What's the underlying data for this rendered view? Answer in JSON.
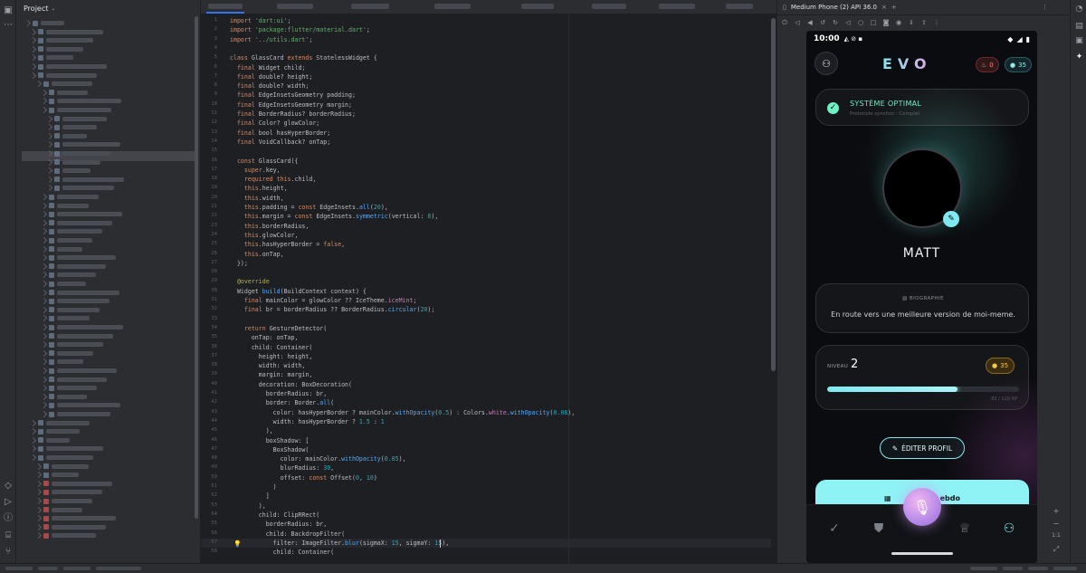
{
  "ide": {
    "project_title": "Project",
    "editor": {
      "lines": [
        {
          "n": "1",
          "html": "<span class='kw'>import</span> <span class='str'>'dart:ui'</span>;"
        },
        {
          "n": "2",
          "html": "<span class='kw'>import</span> <span class='str'>'package:flutter/material.dart'</span>;"
        },
        {
          "n": "3",
          "html": "<span class='kw'>import</span> <span class='str'>'../utils.dart'</span>;"
        },
        {
          "n": "4",
          "html": ""
        },
        {
          "n": "5",
          "html": "<span class='kw'>class</span> GlassCard <span class='kw'>extends</span> StatelessWidget {"
        },
        {
          "n": "6",
          "html": "  <span class='kw'>final</span> Widget child;"
        },
        {
          "n": "7",
          "html": "  <span class='kw'>final</span> double? height;"
        },
        {
          "n": "8",
          "html": "  <span class='kw'>final</span> double? width;"
        },
        {
          "n": "9",
          "html": "  <span class='kw'>final</span> EdgeInsetsGeometry padding;"
        },
        {
          "n": "10",
          "html": "  <span class='kw'>final</span> EdgeInsetsGeometry margin;"
        },
        {
          "n": "11",
          "html": "  <span class='kw'>final</span> BorderRadius? borderRadius;"
        },
        {
          "n": "12",
          "html": "  <span class='kw'>final</span> Color? glowColor;"
        },
        {
          "n": "13",
          "html": "  <span class='kw'>final</span> bool hasHyperBorder;"
        },
        {
          "n": "14",
          "html": "  <span class='kw'>final</span> VoidCallback? onTap;"
        },
        {
          "n": "15",
          "html": ""
        },
        {
          "n": "16",
          "html": "  <span class='kw'>const</span> GlassCard({"
        },
        {
          "n": "17",
          "html": "    <span class='kw'>super</span>.key,"
        },
        {
          "n": "18",
          "html": "    <span class='kw'>required this</span>.child,"
        },
        {
          "n": "19",
          "html": "    <span class='kw'>this</span>.height,"
        },
        {
          "n": "20",
          "html": "    <span class='kw'>this</span>.width,"
        },
        {
          "n": "21",
          "html": "    <span class='kw'>this</span>.padding = <span class='kw'>const</span> EdgeInsets.<span class='fn'>all</span>(<span class='num'>20</span>),"
        },
        {
          "n": "22",
          "html": "    <span class='kw'>this</span>.margin = <span class='kw'>const</span> EdgeInsets.<span class='fn'>symmetric</span>(vertical: <span class='num'>8</span>),"
        },
        {
          "n": "23",
          "html": "    <span class='kw'>this</span>.borderRadius,"
        },
        {
          "n": "24",
          "html": "    <span class='kw'>this</span>.glowColor,"
        },
        {
          "n": "25",
          "html": "    <span class='kw'>this</span>.hasHyperBorder = <span class='kw'>false</span>,"
        },
        {
          "n": "26",
          "html": "    <span class='kw'>this</span>.onTap,"
        },
        {
          "n": "27",
          "html": "  });"
        },
        {
          "n": "28",
          "html": ""
        },
        {
          "n": "29",
          "html": "  <span class='ann'>@override</span>"
        },
        {
          "n": "30",
          "html": "  Widget <span class='fn'>build</span>(BuildContext context) {"
        },
        {
          "n": "31",
          "html": "    <span class='kw'>final</span> mainColor = glowColor ?? IceTheme.<span class='fld'>iceMint</span>;"
        },
        {
          "n": "32",
          "html": "    <span class='kw'>final</span> br = borderRadius ?? BorderRadius.<span class='fn'>circular</span>(<span class='num'>20</span>);"
        },
        {
          "n": "33",
          "html": ""
        },
        {
          "n": "34",
          "html": "    <span class='kw'>return</span> GestureDetector("
        },
        {
          "n": "35",
          "html": "      onTap: onTap,"
        },
        {
          "n": "36",
          "html": "      child: Container("
        },
        {
          "n": "37",
          "html": "        height: height,"
        },
        {
          "n": "38",
          "html": "        width: width,"
        },
        {
          "n": "39",
          "html": "        margin: margin,"
        },
        {
          "n": "40",
          "html": "        decoration: BoxDecoration("
        },
        {
          "n": "41",
          "html": "          borderRadius: br,"
        },
        {
          "n": "42",
          "html": "          border: Border.<span class='fn'>all</span>("
        },
        {
          "n": "43",
          "html": "            color: hasHyperBorder ? mainColor.<span class='fn'>withOpacity</span>(<span class='num'>0.5</span>) : Colors.<span class='fld'>white</span>.<span class='fn'>withOpacity</span>(<span class='num'>0.08</span>),"
        },
        {
          "n": "44",
          "html": "            width: hasHyperBorder ? <span class='num'>1.5</span> : <span class='num'>1</span>"
        },
        {
          "n": "45",
          "html": "          ),"
        },
        {
          "n": "46",
          "html": "          boxShadow: ["
        },
        {
          "n": "47",
          "html": "            BoxShadow("
        },
        {
          "n": "48",
          "html": "              color: mainColor.<span class='fn'>withOpacity</span>(<span class='num'>0.05</span>),"
        },
        {
          "n": "49",
          "html": "              blurRadius: <span class='num'>30</span>,"
        },
        {
          "n": "50",
          "html": "              offset: <span class='kw'>const</span> Offset(<span class='num'>0</span>, <span class='num'>10</span>)"
        },
        {
          "n": "51",
          "html": "            )"
        },
        {
          "n": "52",
          "html": "          ]"
        },
        {
          "n": "53",
          "html": "        ),"
        },
        {
          "n": "54",
          "html": "        child: ClipRRect("
        },
        {
          "n": "55",
          "html": "          borderRadius: br,"
        },
        {
          "n": "56",
          "html": "          child: BackdropFilter("
        },
        {
          "n": "57",
          "html": "            filter: ImageFilter.<span class='fn'>blur</span>(sigmaX: <span class='num'>15</span>, sigmaY: <span class='num'>15</span>),"
        },
        {
          "n": "58",
          "html": "            child: Container("
        }
      ]
    },
    "emulator": {
      "tab_title": "Medium Phone (2) API 36.0",
      "zoom_ratio": "1:1"
    }
  },
  "phone": {
    "status_time": "10:00",
    "logo": "EVO",
    "streak_count": "0",
    "coin_count": "35",
    "system": {
      "title": "SYSTÈME OPTIMAL",
      "subtitle": "Protocole synchro : Complet"
    },
    "profile_name": "MATT",
    "bio": {
      "label": "BIOGRAPHIE",
      "text": "En route vers une meilleure version de moi-meme."
    },
    "level": {
      "label": "NIVEAU",
      "value": "2",
      "coins": "35",
      "xp_text": "82 / 120 XP",
      "xp_fraction": 0.68
    },
    "edit_profile_label": "ÉDITER PROFIL",
    "weekly_label_start": "",
    "weekly_label_end": "ebdo",
    "colors": {
      "accent_mint": "#7fe9ef",
      "success_green": "#6ff0c3",
      "coin_gold": "#f6c54b",
      "streak_red": "#ff8a7a"
    }
  }
}
